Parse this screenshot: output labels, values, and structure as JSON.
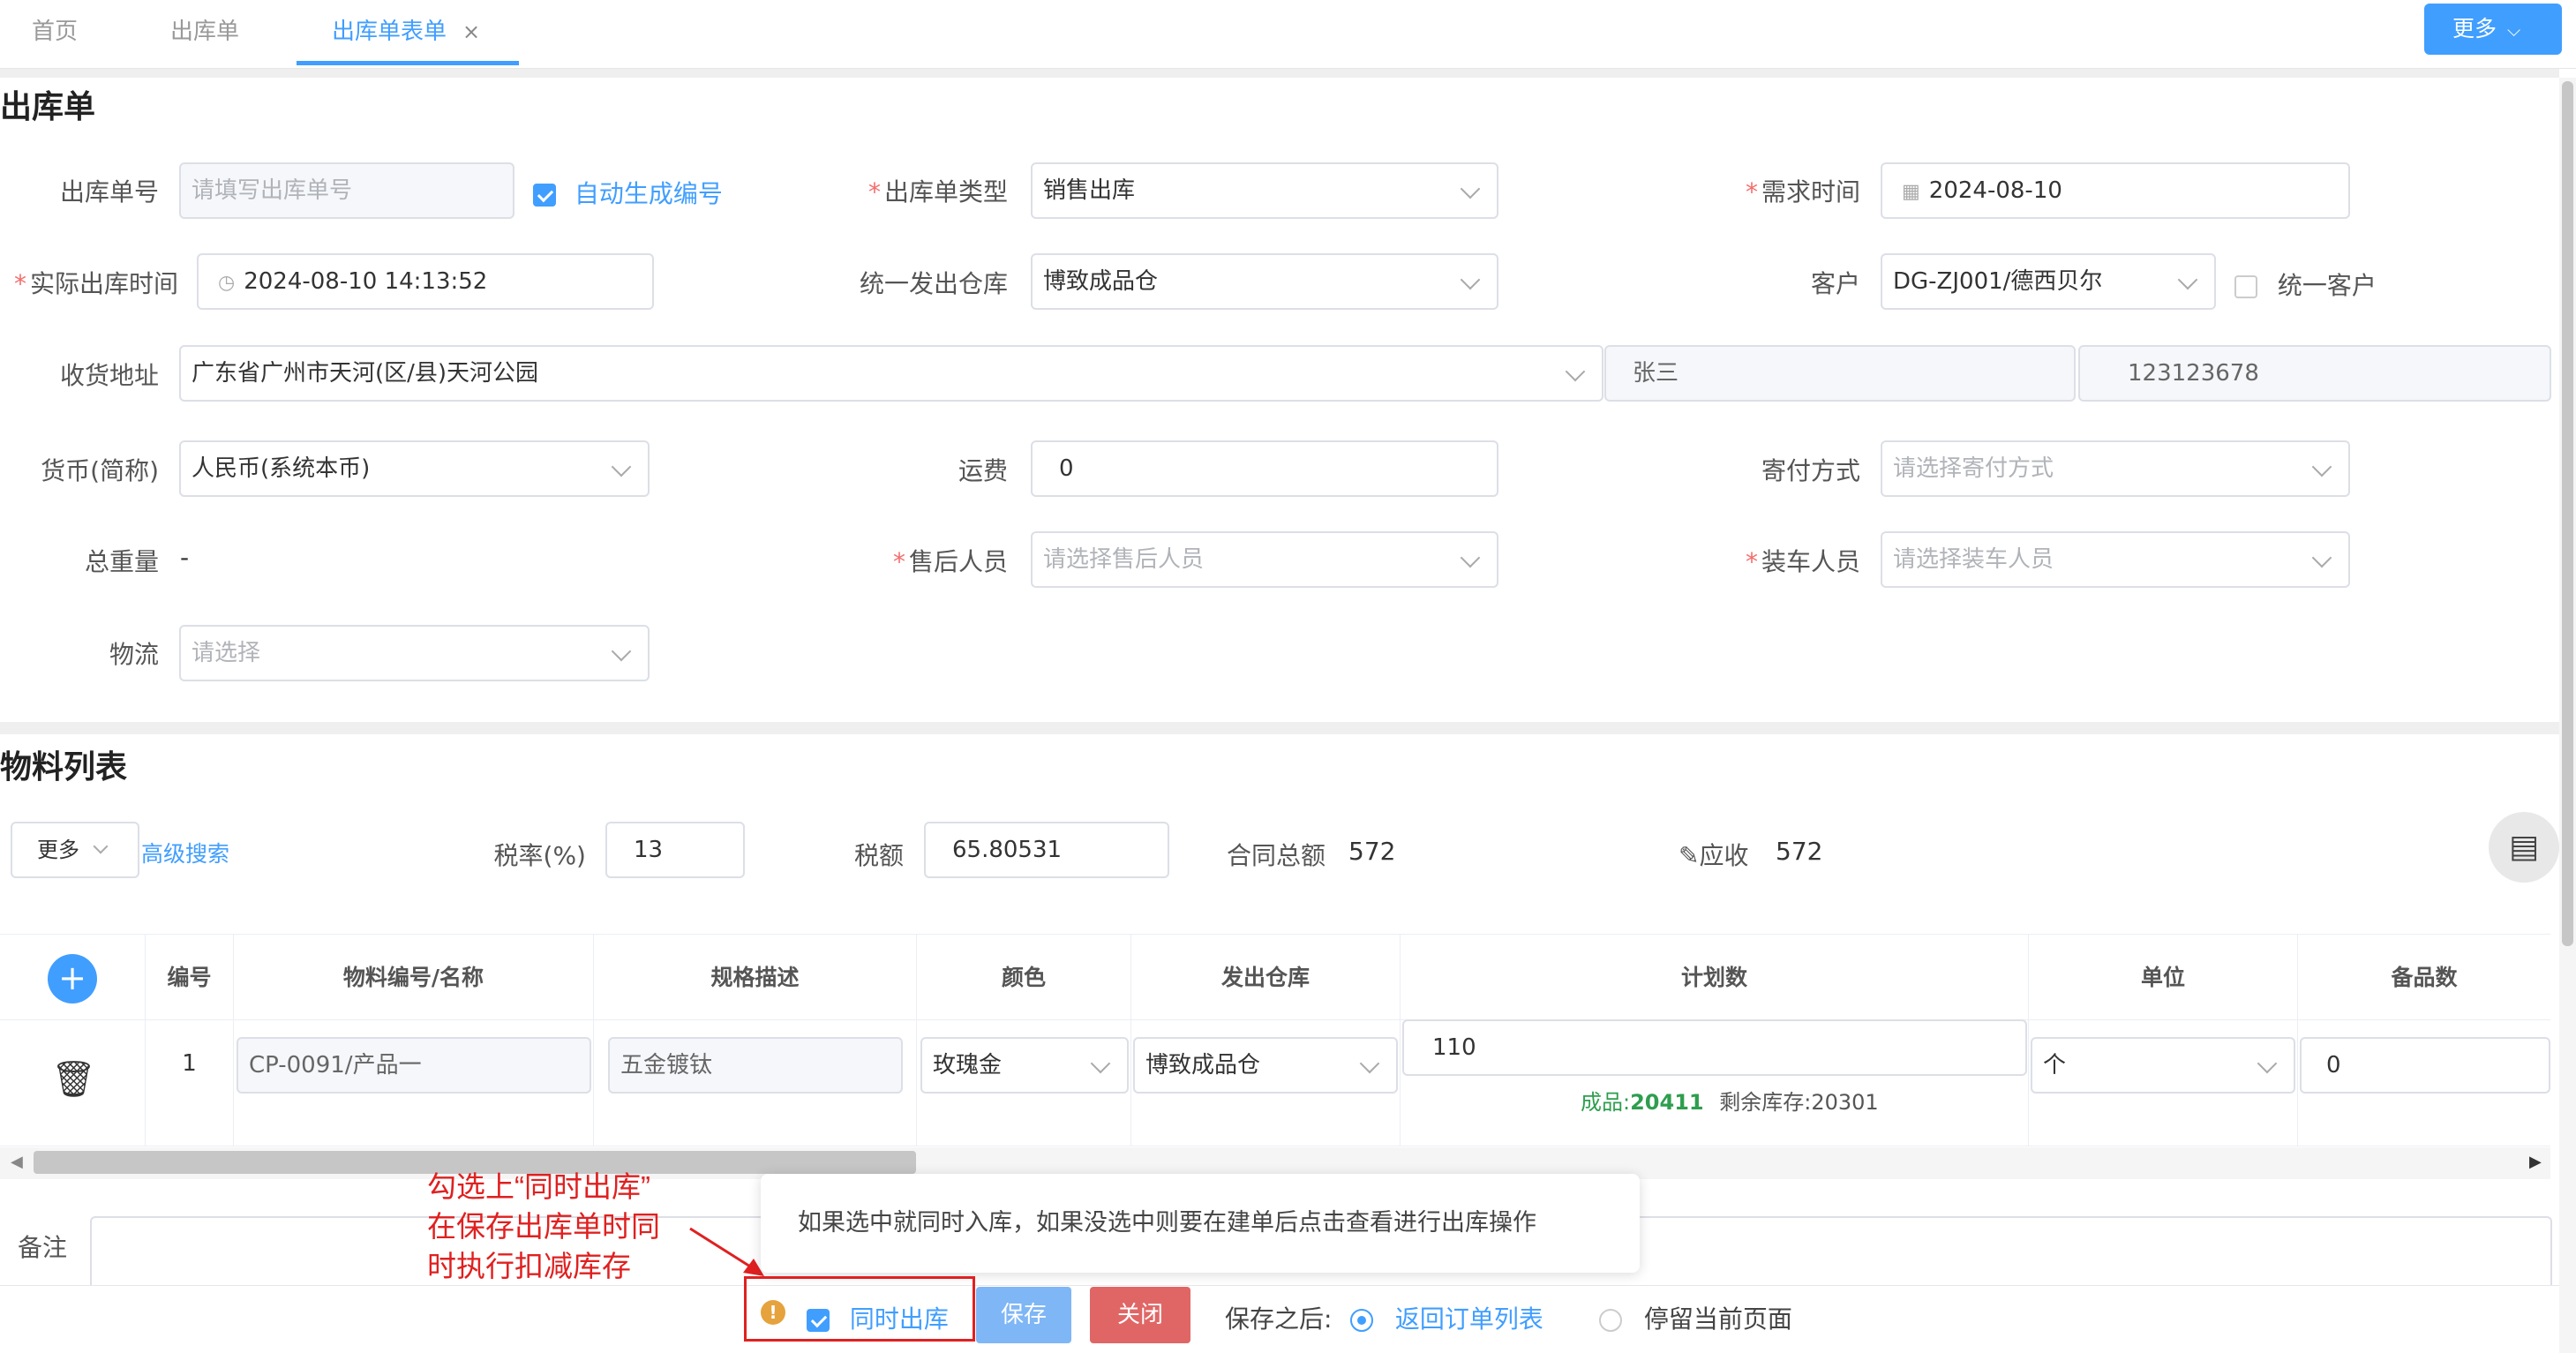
{
  "tabs": {
    "home": "首页",
    "outbound": "出库单",
    "outbound_form": "出库单表单",
    "close_glyph": "×",
    "more": "更多"
  },
  "form": {
    "title": "出库单",
    "order_no": {
      "label": "出库单号",
      "placeholder": "请填写出库单号"
    },
    "auto_gen": {
      "label": "自动生成编号",
      "checked": true
    },
    "order_type": {
      "label": "出库单类型",
      "value": "销售出库"
    },
    "demand_time": {
      "label": "需求时间",
      "value": "2024-08-10"
    },
    "actual_time": {
      "label": "实际出库时间",
      "value": "2024-08-10 14:13:52"
    },
    "warehouse": {
      "label": "统一发出仓库",
      "value": "博致成品仓"
    },
    "customer": {
      "label": "客户",
      "value": "DG-ZJ001/德西贝尔"
    },
    "unify_customer": {
      "label": "统一客户",
      "checked": false
    },
    "address": {
      "label": "收货地址",
      "value": "广东省广州市天河(区/县)天河公园",
      "contact": "张三",
      "phone": "123123678"
    },
    "currency": {
      "label": "货币(简称)",
      "value": "人民币(系统本币)"
    },
    "freight": {
      "label": "运费",
      "value": "0"
    },
    "shipping": {
      "label": "寄付方式",
      "placeholder": "请选择寄付方式"
    },
    "total_weight": {
      "label": "总重量",
      "value": "-"
    },
    "after_sales": {
      "label": "售后人员",
      "placeholder": "请选择售后人员"
    },
    "loader": {
      "label": "装车人员",
      "placeholder": "请选择装车人员"
    },
    "logistics": {
      "label": "物流",
      "placeholder": "请选择"
    }
  },
  "materials": {
    "title": "物料列表",
    "more": "更多",
    "advanced_search": "高级搜索",
    "tax_rate": {
      "label": "税率(%)",
      "value": "13"
    },
    "tax_amount": {
      "label": "税额",
      "value": "65.80531"
    },
    "contract_total": {
      "label": "合同总额",
      "value": "572"
    },
    "receivable": {
      "label": "应收",
      "value": "572"
    },
    "columns": [
      "编号",
      "物料编号/名称",
      "规格描述",
      "颜色",
      "发出仓库",
      "计划数",
      "单位",
      "备品数"
    ],
    "rows": [
      {
        "no": "1",
        "material": "CP-0091/产品一",
        "spec": "五金镀钛",
        "color": "玫瑰金",
        "warehouse": "博致成品仓",
        "plan_qty": "110",
        "stock_prefix": "成品:",
        "stock_value": "20411",
        "remaining": "剩余库存:20301",
        "unit": "个",
        "spare": "0"
      }
    ]
  },
  "remark": {
    "label": "备注"
  },
  "annotation": {
    "line1": "勾选上“同时出库”",
    "line2": "在保存出库单时同",
    "line3": "时执行扣减库存",
    "color": "#e02020"
  },
  "tooltip": "如果选中就同时入库，如果没选中则要在建单后点击查看进行出库操作",
  "footer": {
    "simultaneous": "同时出库",
    "save": "保存",
    "close": "关闭",
    "after_save": "保存之后:",
    "return_list": "返回订单列表",
    "stay": "停留当前页面"
  },
  "colors": {
    "primary": "#409eff",
    "danger": "#e06666",
    "success": "#2e9e4e",
    "warning": "#e6a23c"
  }
}
